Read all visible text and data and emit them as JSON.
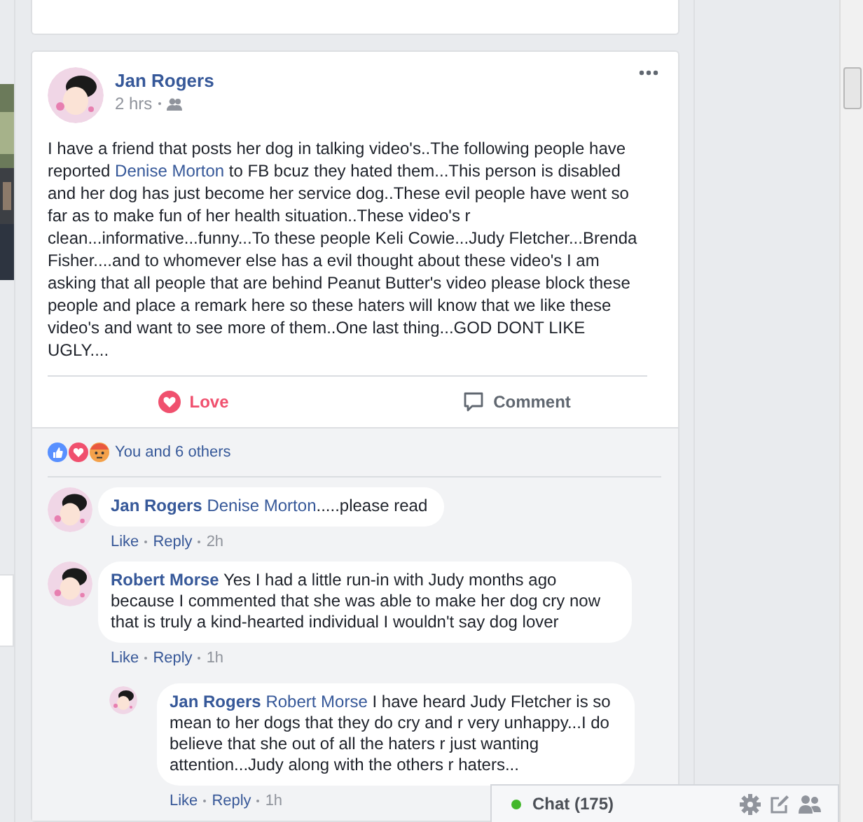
{
  "post": {
    "author": "Jan Rogers",
    "time": "2 hrs",
    "body": [
      {
        "kind": "text",
        "text": "I have a friend that posts her dog in talking video's..The following people have reported "
      },
      {
        "kind": "link",
        "text": "Denise Morton"
      },
      {
        "kind": "text",
        "text": " to FB bcuz they hated them...This person is disabled and her dog has just become her service dog..These evil people have went so far as to make fun of her health situation..These video's r clean...informative...funny...To these people Keli Cowie...Judy Fletcher...Brenda Fisher....and to whomever else has a evil thought about these video's I am asking that all people that are behind Peanut Butter's video please block these people and place a remark here so these haters will know that we like these video's and want to see more of them..One last thing...GOD DONT LIKE UGLY...."
      }
    ],
    "actions": [
      {
        "kind": "love",
        "label": "Love",
        "selected": true
      },
      {
        "kind": "comment",
        "label": "Comment",
        "selected": false
      }
    ],
    "reactions": {
      "summary": "You and 6 others"
    }
  },
  "comments": [
    {
      "author": "Jan Rogers",
      "mention": "Denise Morton",
      "text": ".....please read",
      "like": "Like",
      "reply": "Reply",
      "time": "2h"
    },
    {
      "author": "Robert Morse",
      "text": "Yes I had a little run-in with Judy months ago because I commented that she was able to make her dog cry now that is truly a kind-hearted individual I wouldn't say dog lover",
      "like": "Like",
      "reply": "Reply",
      "time": "1h",
      "children": [
        {
          "author": "Jan Rogers",
          "mention": "Robert Morse",
          "text": " I have heard Judy Fletcher is so mean to her dogs that they do cry and r very unhappy...I do believe that she out of all the haters r just wanting attention...Judy along with the others r haters...",
          "like": "Like",
          "reply": "Reply",
          "time": "1h"
        }
      ]
    }
  ],
  "chat": {
    "label": "Chat (175)",
    "online": true
  }
}
